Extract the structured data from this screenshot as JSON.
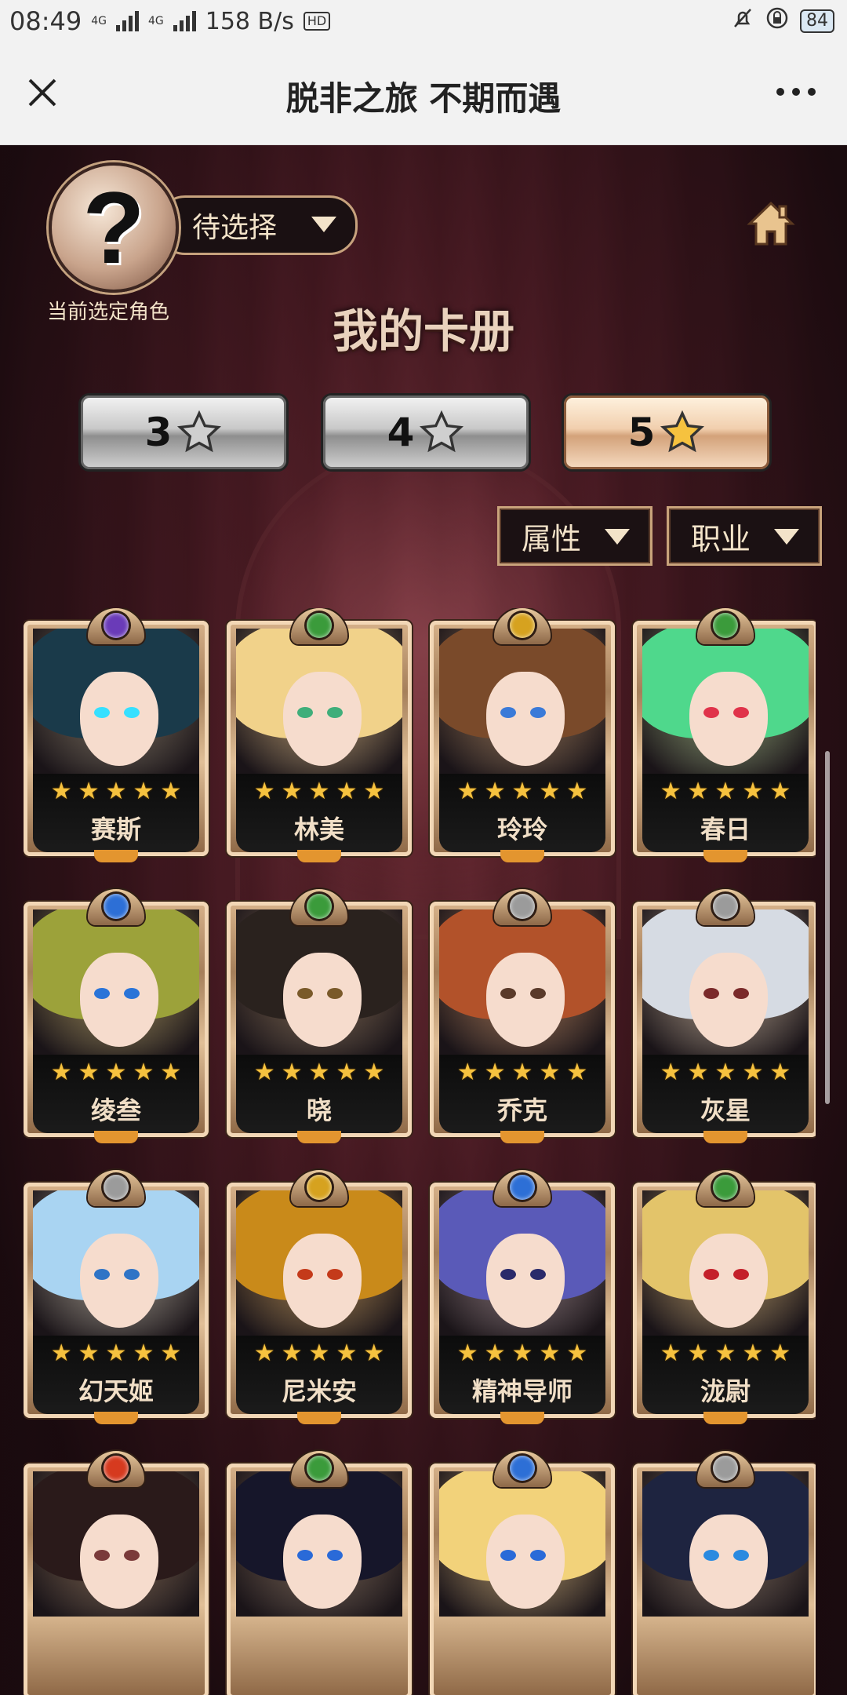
{
  "status_bar": {
    "time": "08:49",
    "net_speed": "158 B/s",
    "battery": "84",
    "sim1": "4G",
    "sim2": "4G",
    "hd": "HD"
  },
  "title_bar": {
    "title": "脱非之旅 不期而遇"
  },
  "selector": {
    "avatar_glyph": "?",
    "dropdown_label": "待选择",
    "caption": "当前选定角色"
  },
  "album_title": "我的卡册",
  "star_tabs": [
    {
      "label": "3",
      "active": false
    },
    {
      "label": "4",
      "active": false
    },
    {
      "label": "5",
      "active": true
    }
  ],
  "filters": {
    "attribute": "属性",
    "profession": "职业"
  },
  "cards": [
    {
      "name": "赛斯",
      "stars": 5,
      "gem": "#6a3bb8",
      "hair": "#1a3a4a",
      "eye": "#36e0ff"
    },
    {
      "name": "林美",
      "stars": 5,
      "gem": "#3b9b3b",
      "hair": "#f1d28a",
      "eye": "#3fae7a"
    },
    {
      "name": "玲玲",
      "stars": 5,
      "gem": "#d6a21f",
      "hair": "#7a4a2a",
      "eye": "#3a7ad8"
    },
    {
      "name": "春日",
      "stars": 5,
      "gem": "#3b9b3b",
      "hair": "#4fd88c",
      "eye": "#e0334a"
    },
    {
      "name": "绫叁",
      "stars": 5,
      "gem": "#2d6fd6",
      "hair": "#9ca23a",
      "eye": "#2a74d8"
    },
    {
      "name": "晓",
      "stars": 5,
      "gem": "#3b9b3b",
      "hair": "#2a221e",
      "eye": "#7a5a2a"
    },
    {
      "name": "乔克",
      "stars": 5,
      "gem": "#9b9b9b",
      "hair": "#b2522a",
      "eye": "#5a3a2a"
    },
    {
      "name": "灰星",
      "stars": 5,
      "gem": "#9b9b9b",
      "hair": "#d6dbe3",
      "eye": "#7a2a2a"
    },
    {
      "name": "幻天姬",
      "stars": 5,
      "gem": "#9b9b9b",
      "hair": "#a9d4f2",
      "eye": "#2f74c6"
    },
    {
      "name": "尼米安",
      "stars": 5,
      "gem": "#d6a21f",
      "hair": "#c98a1a",
      "eye": "#c43a1a"
    },
    {
      "name": "精神导师",
      "stars": 5,
      "gem": "#2d6fd6",
      "hair": "#5a5ab8",
      "eye": "#2a2a6a"
    },
    {
      "name": "泷尉",
      "stars": 5,
      "gem": "#3b9b3b",
      "hair": "#e3c46a",
      "eye": "#c4202a"
    },
    {
      "name": "",
      "stars": 0,
      "gem": "#d63a1f",
      "hair": "#2a1a1a",
      "eye": "#7a3a3a"
    },
    {
      "name": "",
      "stars": 0,
      "gem": "#3b9b3b",
      "hair": "#16162a",
      "eye": "#2a6ad8"
    },
    {
      "name": "",
      "stars": 0,
      "gem": "#2d6fd6",
      "hair": "#f2d27a",
      "eye": "#2a6ad8"
    },
    {
      "name": "",
      "stars": 0,
      "gem": "#9b9b9b",
      "hair": "#1e2440",
      "eye": "#2a8ae0"
    }
  ]
}
